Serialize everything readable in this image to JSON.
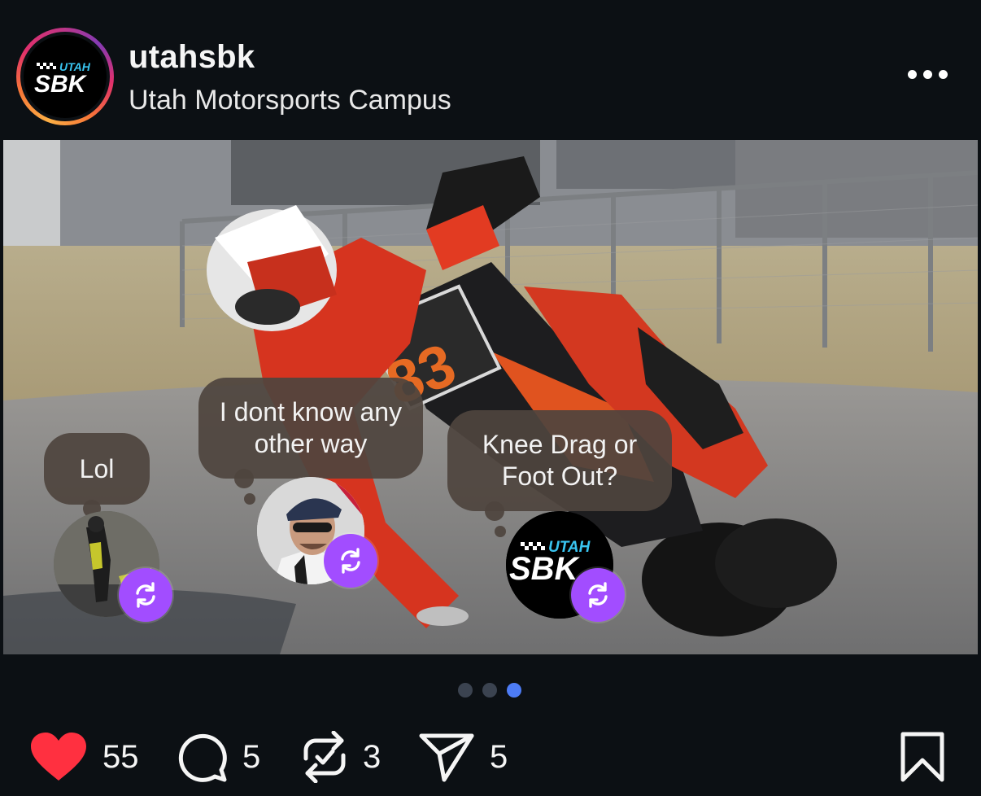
{
  "post": {
    "username": "utahsbk",
    "location": "Utah Motorsports Campus",
    "avatar_logo": {
      "top": "UTAH",
      "main": "SBK"
    },
    "more_icon": "more-horizontal-icon"
  },
  "replies": [
    {
      "text": "Lol",
      "badge_icon": "repost-icon"
    },
    {
      "text": "I dont know any other way",
      "badge_icon": "repost-icon"
    },
    {
      "text": "Knee Drag or Foot Out?",
      "badge_icon": "repost-icon",
      "avatar_logo": {
        "top": "UTAH",
        "main": "SBK"
      }
    }
  ],
  "rider_number": "83",
  "carousel": {
    "total": 3,
    "active_index": 2
  },
  "actions": {
    "likes": {
      "icon": "heart-icon",
      "count": "55",
      "liked": true
    },
    "comments": {
      "icon": "comment-icon",
      "count": "5"
    },
    "reposts": {
      "icon": "repost-icon",
      "count": "3"
    },
    "shares": {
      "icon": "send-icon",
      "count": "5"
    },
    "save": {
      "icon": "bookmark-icon"
    }
  },
  "colors": {
    "background": "#0c1014",
    "like": "#ff3040",
    "repost_badge": "#a24dff",
    "active_dot": "#4d7cf6",
    "inactive_dot": "#3b4350"
  }
}
